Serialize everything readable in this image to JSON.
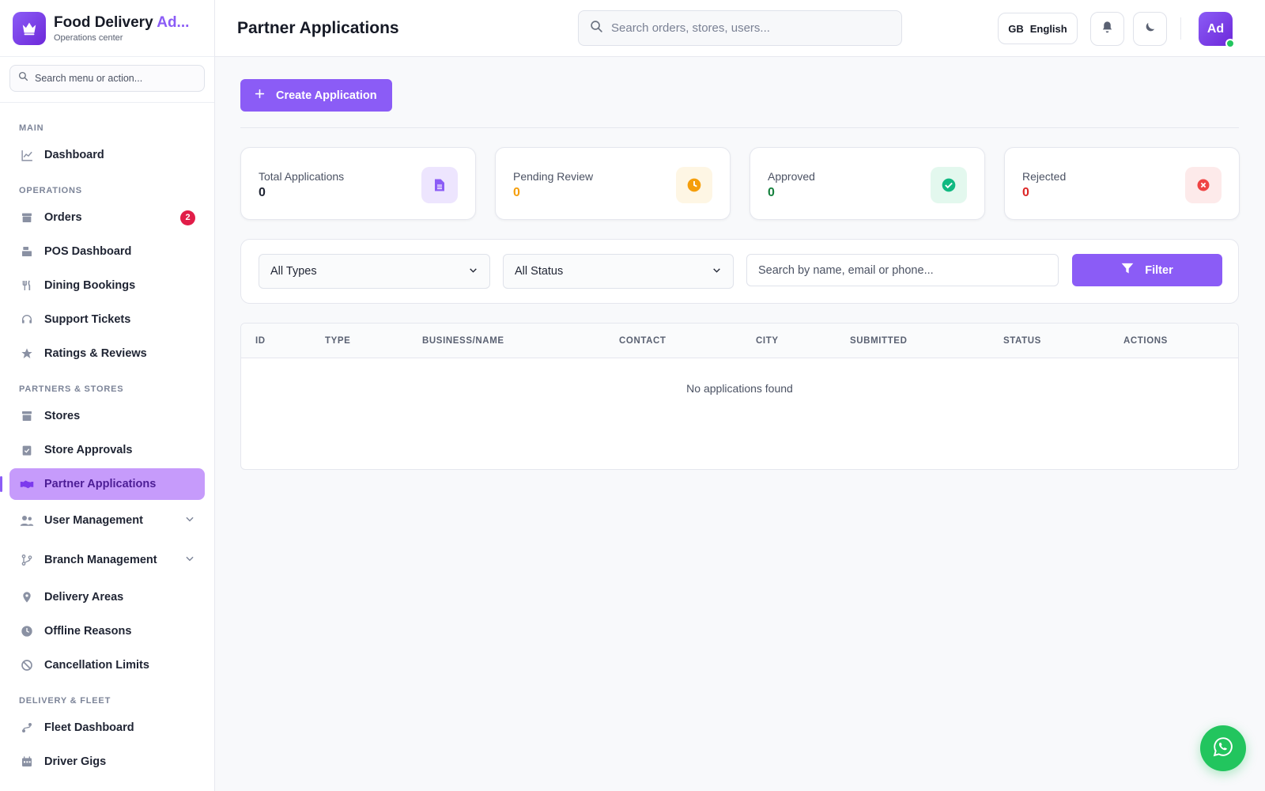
{
  "brand": {
    "title_main": "Food Delivery ",
    "title_accent": "Ad...",
    "subtitle": "Operations center"
  },
  "sidebar_search": {
    "placeholder": "Search menu or action..."
  },
  "nav": {
    "main_label": "MAIN",
    "dashboard": "Dashboard",
    "operations_label": "OPERATIONS",
    "orders": "Orders",
    "orders_badge": "2",
    "pos_dashboard": "POS Dashboard",
    "dining_bookings": "Dining Bookings",
    "support_tickets": "Support Tickets",
    "ratings_reviews": "Ratings & Reviews",
    "partners_label": "PARTNERS & STORES",
    "stores": "Stores",
    "store_approvals": "Store Approvals",
    "partner_applications": "Partner Applications",
    "user_management": "User Management",
    "branch_management": "Branch Management",
    "delivery_areas": "Delivery Areas",
    "offline_reasons": "Offline Reasons",
    "cancellation_limits": "Cancellation Limits",
    "fleet_label": "DELIVERY & FLEET",
    "fleet_dashboard": "Fleet Dashboard",
    "driver_gigs": "Driver Gigs"
  },
  "header": {
    "title": "Partner Applications",
    "search_placeholder": "Search orders, stores, users...",
    "lang_code": "GB",
    "lang_name": "English",
    "avatar": "Ad"
  },
  "main": {
    "create_button": "Create Application",
    "stats": [
      {
        "label": "Total Applications",
        "value": "0",
        "color": "#1f2433"
      },
      {
        "label": "Pending Review",
        "value": "0",
        "color": "#f59e0b"
      },
      {
        "label": "Approved",
        "value": "0",
        "color": "#15803d"
      },
      {
        "label": "Rejected",
        "value": "0",
        "color": "#dc2626"
      }
    ],
    "filters": {
      "type_selected": "All Types",
      "status_selected": "All Status",
      "search_placeholder": "Search by name, email or phone...",
      "filter_button": "Filter"
    },
    "table": {
      "columns": [
        "ID",
        "TYPE",
        "BUSINESS/NAME",
        "CONTACT",
        "CITY",
        "SUBMITTED",
        "STATUS",
        "ACTIONS"
      ],
      "empty_message": "No applications found"
    }
  },
  "colors": {
    "accent": "#8b5cf6",
    "whatsapp": "#22c55e"
  }
}
